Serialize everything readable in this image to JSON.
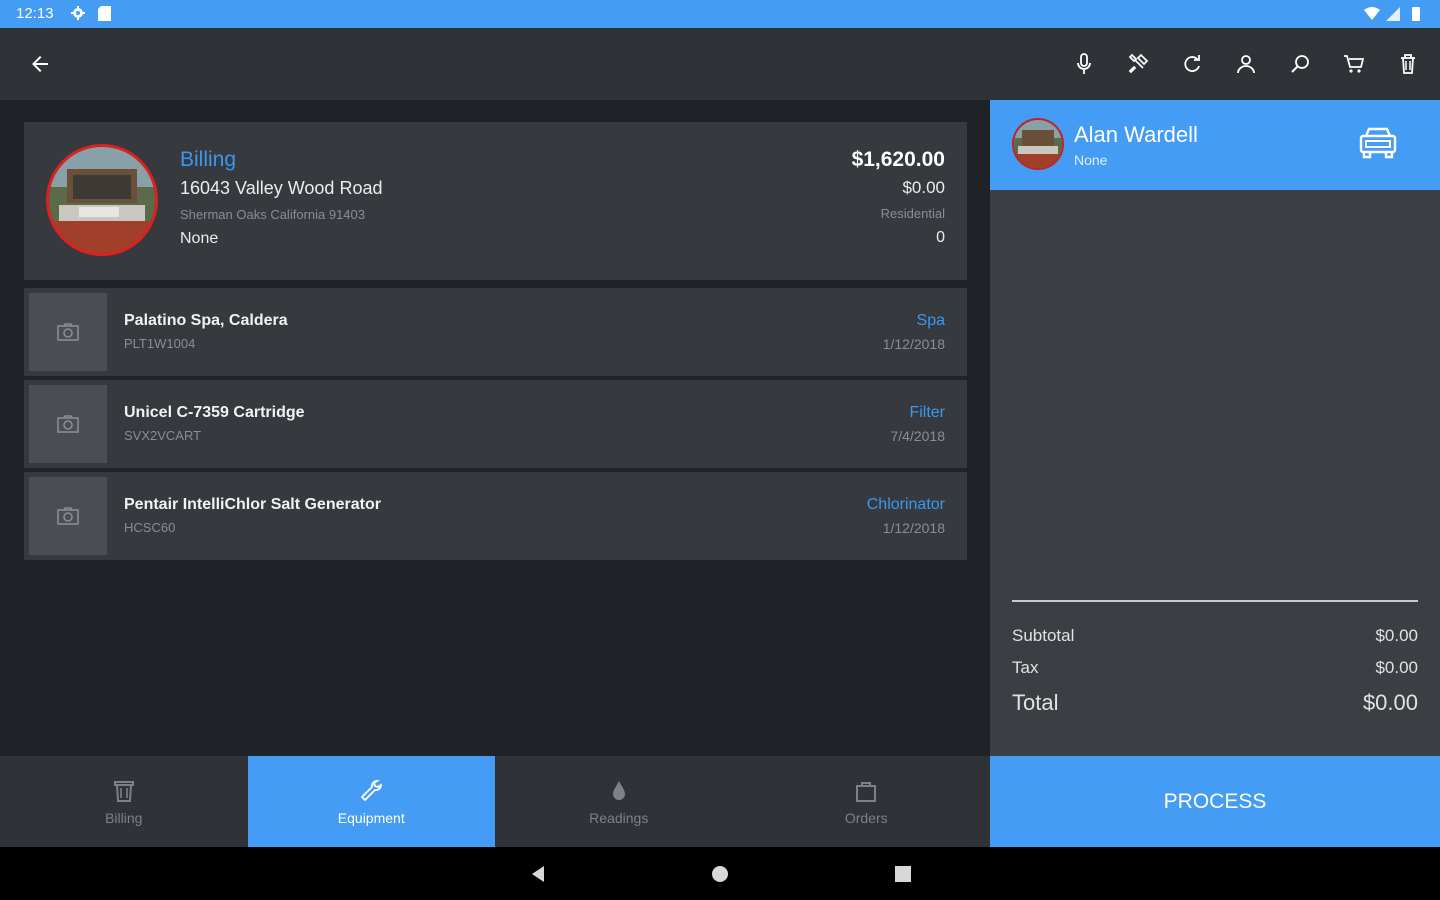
{
  "status_bar": {
    "time": "12:13"
  },
  "billing": {
    "title": "Billing",
    "address": "16043 Valley Wood Road",
    "city_line": "Sherman Oaks  California  91403",
    "note": "None",
    "amount": "$1,620.00",
    "balance": "$0.00",
    "type": "Residential",
    "count": "0"
  },
  "equipment": [
    {
      "name": "Palatino Spa, Caldera",
      "serial": "PLT1W1004",
      "type": "Spa",
      "date": "1/12/2018"
    },
    {
      "name": "Unicel C-7359 Cartridge",
      "serial": "SVX2VCART",
      "type": "Filter",
      "date": "7/4/2018"
    },
    {
      "name": "Pentair IntelliChlor Salt Generator",
      "serial": "HCSC60",
      "type": "Chlorinator",
      "date": "1/12/2018"
    }
  ],
  "bottom_nav": [
    {
      "label": "Billing",
      "icon": "trash-bin-icon",
      "active": false
    },
    {
      "label": "Equipment",
      "icon": "wrench-icon",
      "active": true
    },
    {
      "label": "Readings",
      "icon": "water-drop-icon",
      "active": false
    },
    {
      "label": "Orders",
      "icon": "bag-icon",
      "active": false
    }
  ],
  "customer": {
    "name": "Alan Wardell",
    "subtitle": "None"
  },
  "totals": {
    "subtotal_label": "Subtotal",
    "subtotal_value": "$0.00",
    "tax_label": "Tax",
    "tax_value": "$0.00",
    "total_label": "Total",
    "total_value": "$0.00"
  },
  "process_label": "PROCESS",
  "colors": {
    "accent": "#449cf4",
    "link": "#3a98f0",
    "card": "#36393e",
    "background": "#1f2226"
  }
}
